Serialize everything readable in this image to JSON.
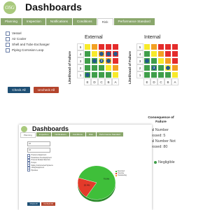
{
  "app": {
    "title": "Dashboards",
    "logo_text": "OSG"
  },
  "tabs": [
    "Planning",
    "Inspection",
    "Notifications",
    "Conditions",
    "Risk",
    "Performance Standard"
  ],
  "active_tab": "Risk",
  "equipment": [
    "Vessel",
    "Air Cooler",
    "Shell and Tube Exchanger",
    "Piping Corrosion Loop"
  ],
  "buttons": {
    "check_all": "Check All",
    "uncheck_all": "Uncheck All"
  },
  "matrices": [
    {
      "title": "External",
      "rows": [
        "5",
        "4",
        "3",
        "2",
        "1"
      ],
      "cols": [
        "E",
        "D",
        "C",
        "B",
        "A"
      ]
    },
    {
      "title": "Internal",
      "rows": [
        "5",
        "4",
        "3",
        "2",
        "1"
      ],
      "cols": [
        "E",
        "D",
        "C",
        "B",
        "A"
      ]
    }
  ],
  "axis": {
    "likelihood": "Likelihood of Failure",
    "consequence_l1": "Consequence of",
    "consequence_l2": "Failure"
  },
  "colors": {
    "red": "#e42c2b",
    "orange": "#f3a122",
    "yellow": "#f7ea2a",
    "green": "#3f9e4a",
    "brand": "#8aa76c",
    "dot": "#23588b"
  },
  "external_dots": [
    {
      "row": 4,
      "col": 2,
      "label": ""
    },
    {
      "row": 4,
      "col": 3,
      "label": ""
    },
    {
      "row": 4,
      "col": 4,
      "label": ""
    },
    {
      "row": 3,
      "col": 1,
      "label": ""
    },
    {
      "row": 3,
      "col": 2,
      "label": "3"
    },
    {
      "row": 3,
      "col": 3,
      "label": ""
    },
    {
      "row": 1,
      "col": 0,
      "label": ""
    }
  ],
  "internal_dots": [
    {
      "row": 3,
      "col": 0,
      "label": ""
    },
    {
      "row": 2,
      "col": 1,
      "label": "3"
    },
    {
      "row": 2,
      "col": 3,
      "label": ""
    }
  ],
  "bottom": {
    "title": "Dashboards",
    "tabs": [
      "Planning",
      "Inspection",
      "Notifications",
      "Conditions",
      "Risk",
      "Performance Standard"
    ],
    "active_tab": "Planning",
    "select_1": "All",
    "select_2": "All",
    "items": [
      "Pressure Equipment",
      "Hazardous Area Equipment",
      "Process Related Electrics",
      "Pumps",
      "Safety Instrumented Systems",
      "Lifting Equipment",
      "Pipelines"
    ],
    "legend": [
      "Executed",
      "Overdue",
      "Outstanding"
    ],
    "buttons": {
      "check_all": "Check All",
      "uncheck_all": "Uncheck All"
    }
  },
  "pie": {
    "type": "pie",
    "values": [
      79.6,
      20.4
    ],
    "labels": [
      "79.6%",
      "20.4%"
    ],
    "colors": [
      "#3fbf3a",
      "#e33a2a"
    ]
  },
  "side_peek": {
    "line1": "al Number",
    "line2": "essed: 5",
    "line3": "al Number Not",
    "line4": "essed: 80",
    "negligible": "Negligible"
  }
}
